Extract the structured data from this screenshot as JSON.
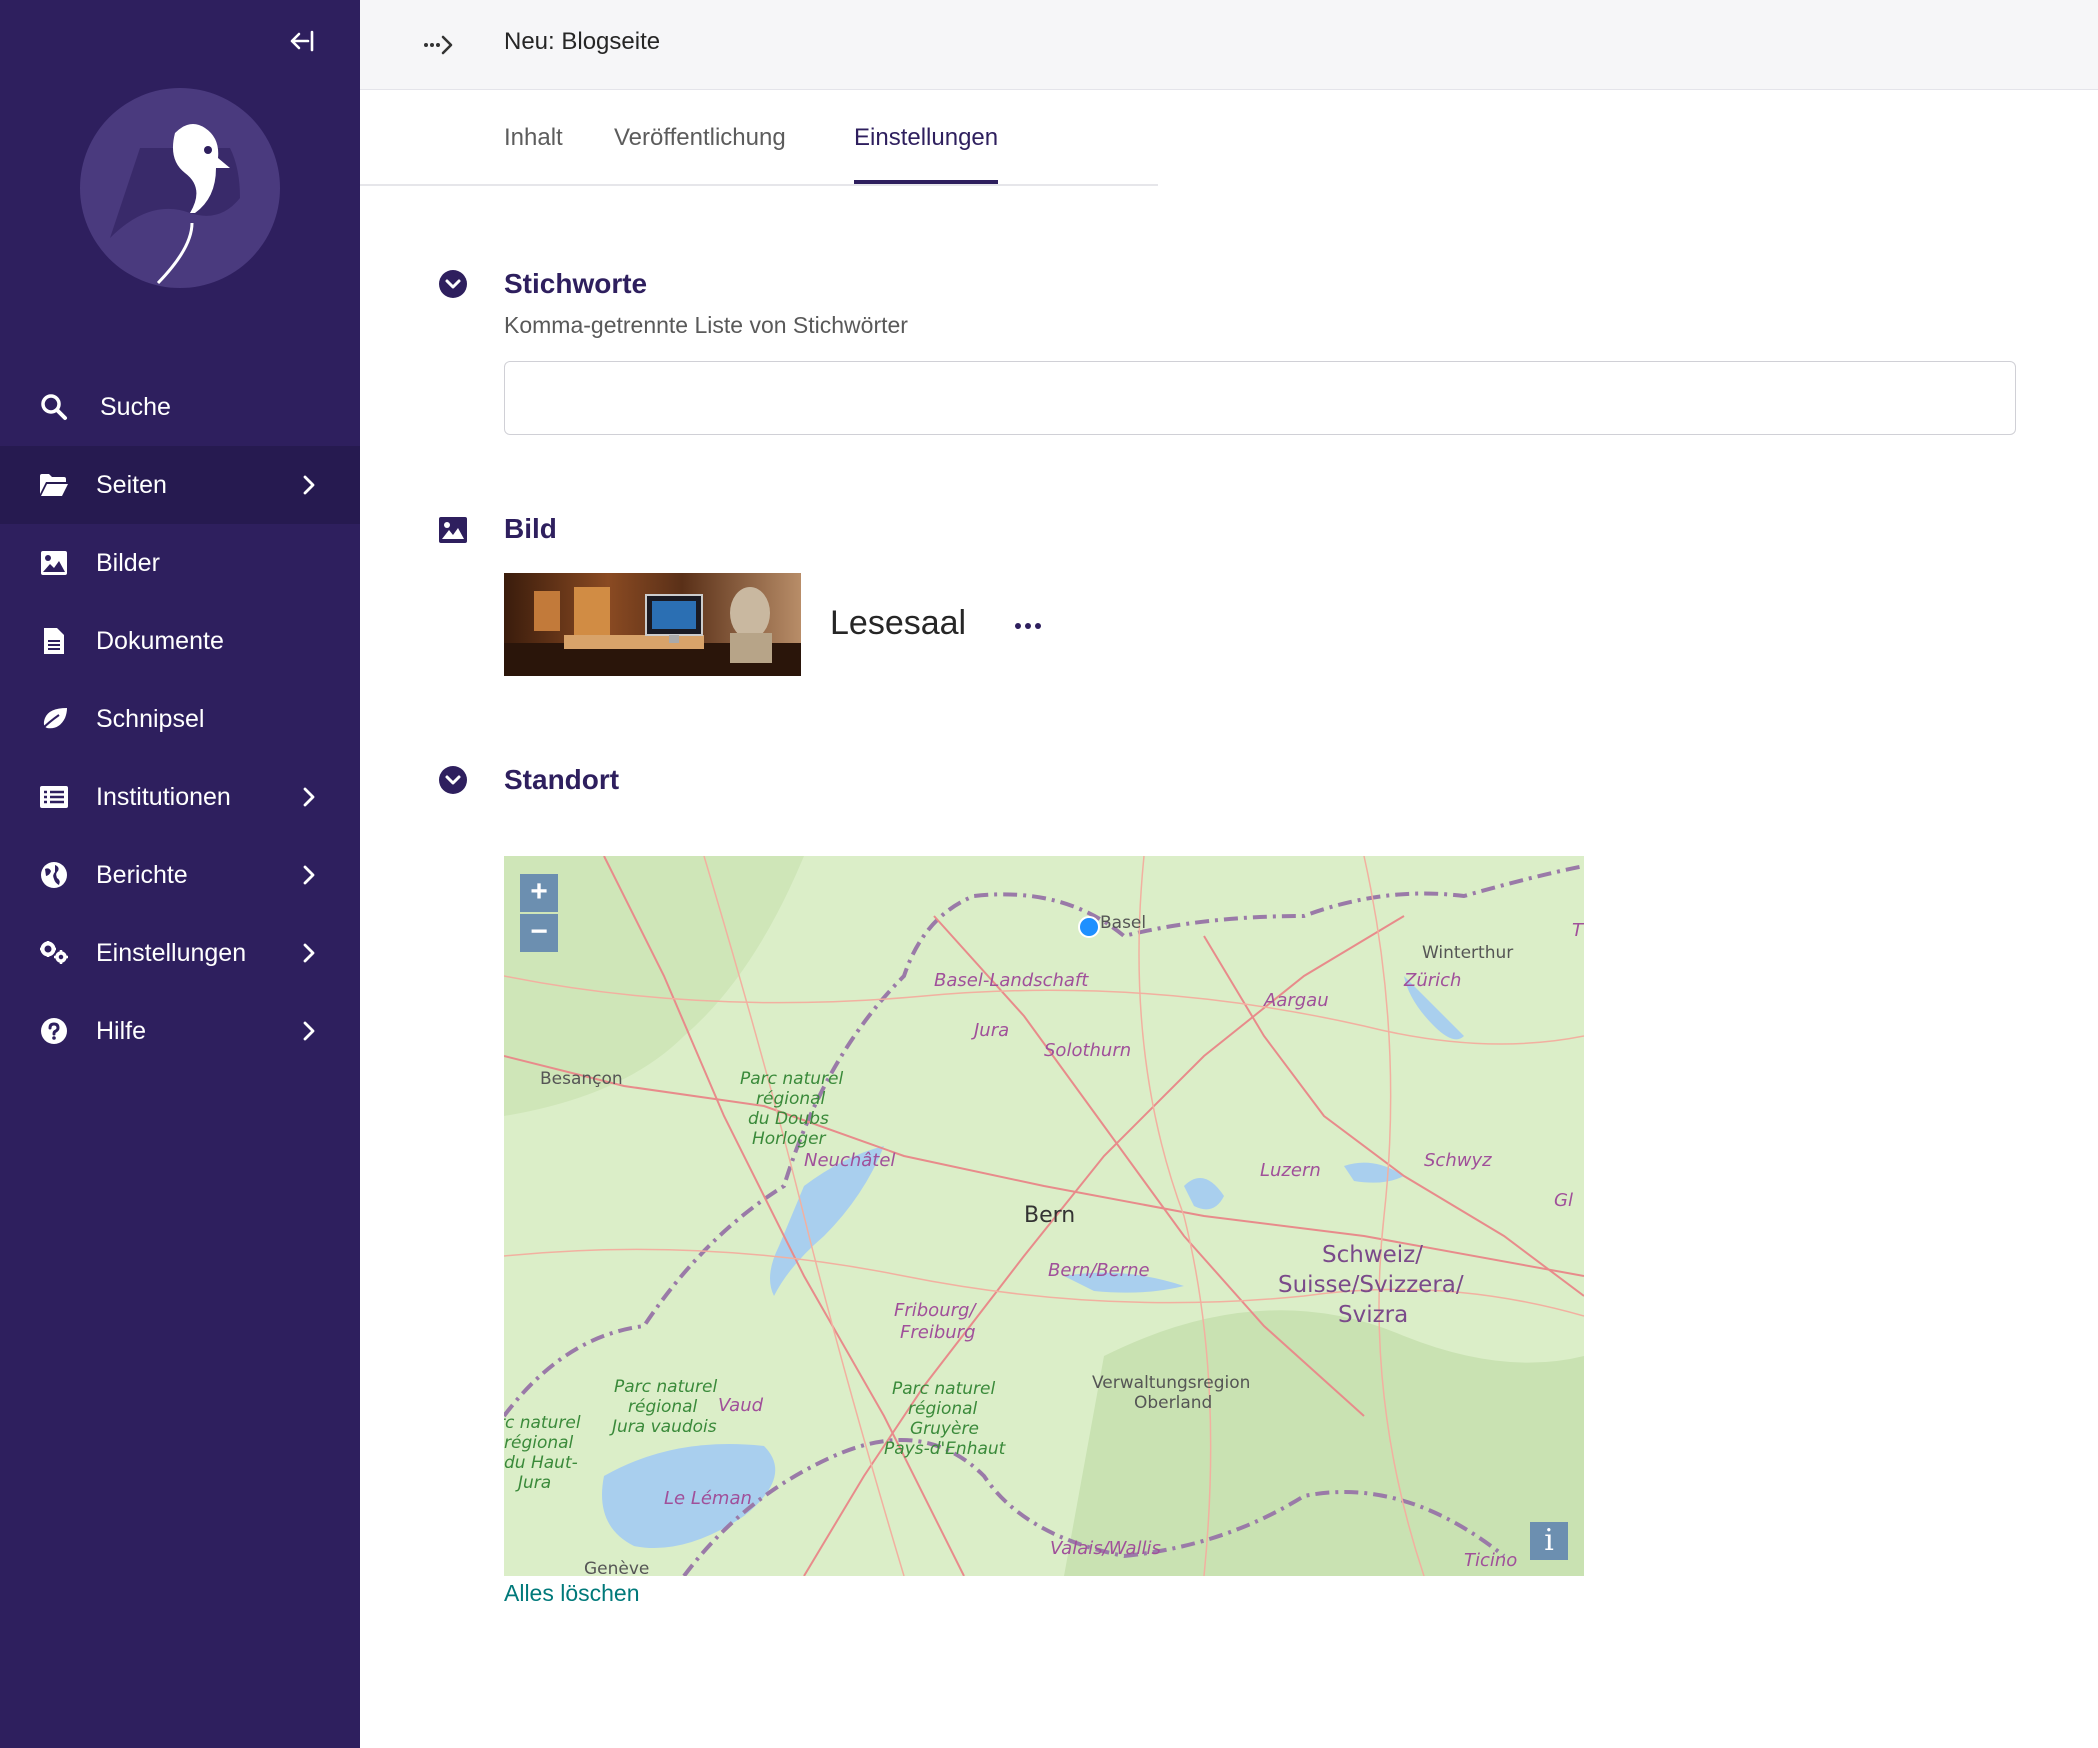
{
  "sidebar": {
    "items": [
      {
        "label": "Suche",
        "icon": "search-icon"
      },
      {
        "label": "Seiten",
        "icon": "folder-open-icon"
      },
      {
        "label": "Bilder",
        "icon": "image-icon"
      },
      {
        "label": "Dokumente",
        "icon": "document-icon"
      },
      {
        "label": "Schnipsel",
        "icon": "leaf-icon"
      },
      {
        "label": "Institutionen",
        "icon": "list-icon"
      },
      {
        "label": "Berichte",
        "icon": "globe-icon"
      },
      {
        "label": "Einstellungen",
        "icon": "cogs-icon"
      },
      {
        "label": "Hilfe",
        "icon": "help-icon"
      }
    ],
    "active_item": "Seiten"
  },
  "header": {
    "title": "Neu: Blogseite"
  },
  "tabs": [
    {
      "label": "Inhalt"
    },
    {
      "label": "Veröffentlichung"
    },
    {
      "label": "Einstellungen"
    }
  ],
  "active_tab": "Einstellungen",
  "tags_section": {
    "title": "Stichworte",
    "help": "Komma-getrennte Liste von Stichwörter",
    "value": ""
  },
  "image_section": {
    "title": "Bild",
    "image_title": "Lesesaal"
  },
  "location_section": {
    "title": "Standort",
    "map_labels": [
      "Basel",
      "Basel-Landschaft",
      "Aargau",
      "Winterthur",
      "Zürich",
      "Jura",
      "Solothurn",
      "Besançon",
      "Parc naturel régional du Doubs Horloger",
      "Neuchâtel",
      "Luzern",
      "Schwyz",
      "Bern",
      "Bern/Berne",
      "Schweiz/ Suisse/Svizzera/ Svizra",
      "Fribourg/ Freiburg",
      "Parc naturel régional Jura vaudois",
      "Vaud",
      "Parc naturel régional Gruyère Pays-d'Enhaut",
      "Verwaltungsregion Oberland",
      "rc naturel régional du Haut- Jura",
      "Le Léman",
      "Valais/Wallis",
      "Ticino",
      "Genève",
      "Gl",
      "T"
    ],
    "zoom_in": "+",
    "zoom_out": "−",
    "info": "i",
    "clear_label": "Alles löschen"
  },
  "colors": {
    "sidebar_bg": "#2e1f5e",
    "sidebar_active": "#261a50",
    "accent": "#2e1f5e",
    "link": "#00797a",
    "map_control": "#6c8fb0"
  }
}
